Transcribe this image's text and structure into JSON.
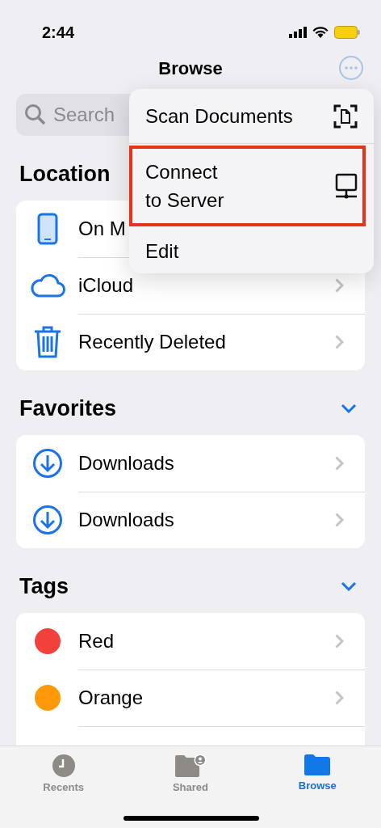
{
  "status_bar": {
    "time": "2:44"
  },
  "nav": {
    "title": "Browse"
  },
  "search": {
    "placeholder": "Search"
  },
  "sections": [
    {
      "title": "Location",
      "collapsible": false,
      "items": [
        {
          "label": "On M",
          "kind": "phone"
        },
        {
          "label": "iCloud",
          "kind": "cloud"
        },
        {
          "label": "Recently Deleted",
          "kind": "trash"
        }
      ]
    },
    {
      "title": "Favorites",
      "collapsible": true,
      "items": [
        {
          "label": "Downloads",
          "kind": "download"
        },
        {
          "label": "Downloads",
          "kind": "download"
        }
      ]
    },
    {
      "title": "Tags",
      "collapsible": true,
      "items": [
        {
          "label": "Red",
          "kind": "tag",
          "color": "#f2403a"
        },
        {
          "label": "Orange",
          "kind": "tag",
          "color": "#fe9a0a"
        },
        {
          "kind": "blank"
        }
      ]
    }
  ],
  "menu": {
    "items": [
      {
        "label": "Scan Documents",
        "kind": "scan",
        "highlighted": false
      },
      {
        "label": "Connect\nto Server",
        "kind": "server",
        "highlighted": true
      },
      {
        "label": "Edit",
        "kind": "plain",
        "highlighted": false
      }
    ]
  },
  "tab_bar": [
    {
      "label": "Recents",
      "selected": false
    },
    {
      "label": "Shared",
      "selected": false
    },
    {
      "label": "Browse",
      "selected": true
    }
  ]
}
